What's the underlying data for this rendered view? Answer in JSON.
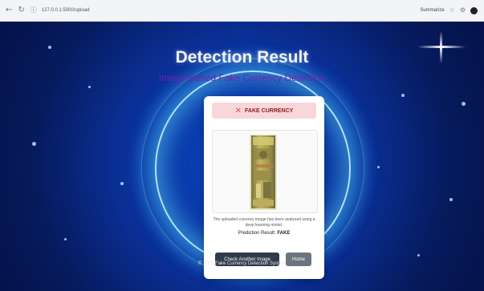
{
  "browser": {
    "url": "127.0.0.1:5000/upload",
    "summarize_label": "Summarize",
    "icons": [
      "back-icon",
      "reload-icon",
      "info-icon",
      "star-icon",
      "extensions-icon",
      "profile-icon"
    ]
  },
  "header": {
    "title": "Detection Result",
    "subtitle": "Image-Based Fake Currency Detection"
  },
  "result": {
    "badge_text": "FAKE CURRENCY",
    "badge_color": "#f8d7da",
    "badge_text_color": "#8a1c22",
    "icon": "x-mark-icon",
    "note": "The uploaded currency image has been analyzed using a deep learning model.",
    "prediction_label": "Prediction Result:",
    "prediction_value": "FAKE"
  },
  "actions": {
    "check_another": "Check Another Image",
    "home": "Home"
  },
  "footer": {
    "text": "© 2025 Fake Currency Detection System"
  },
  "colors": {
    "subtitle": "#7b1fa2",
    "primary_button": "#2d3b4a",
    "secondary_button": "#6c757d"
  }
}
